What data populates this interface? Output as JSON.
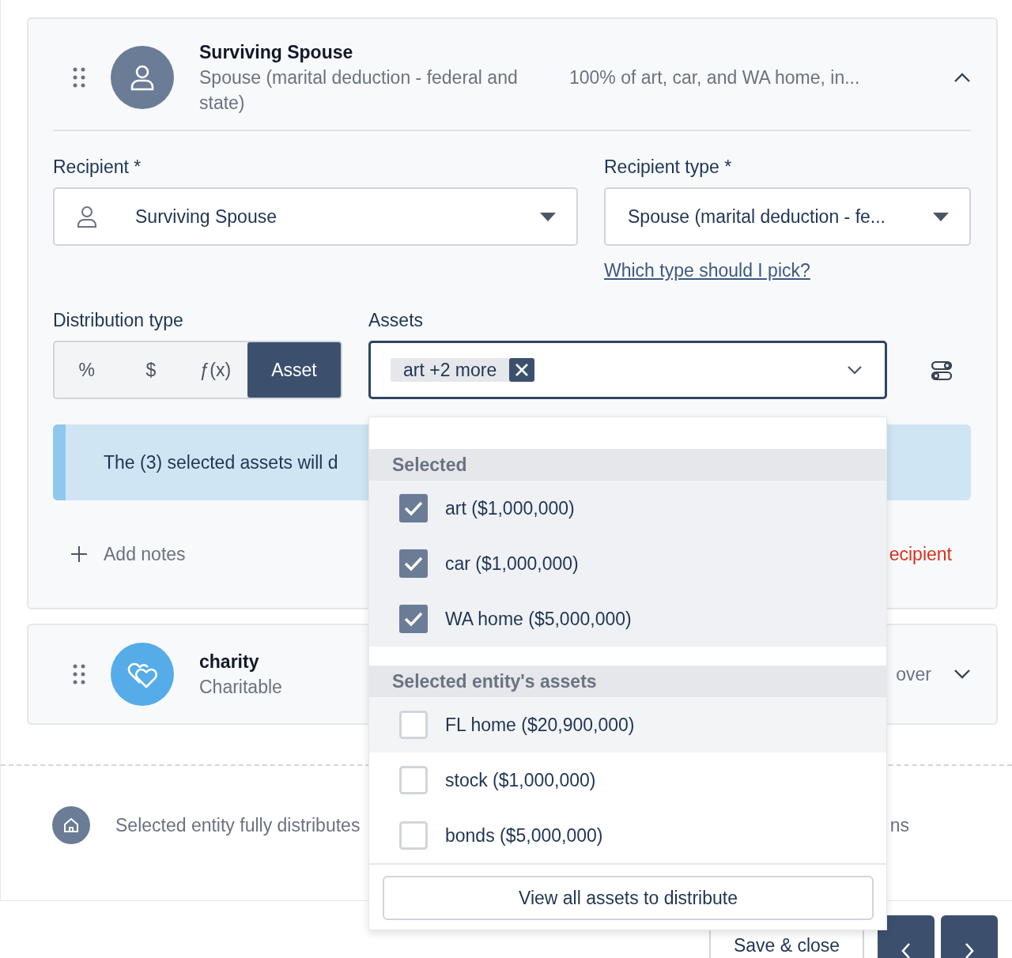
{
  "recipients": [
    {
      "kind": "person",
      "name": "Surviving Spouse",
      "type": "Spouse (marital deduction - federal and state)",
      "summary": "100% of art, car, and WA home, in...",
      "expanded": true
    },
    {
      "kind": "charity",
      "name": "charity",
      "type": "Charitable",
      "summary": "over",
      "expanded": false
    }
  ],
  "form": {
    "recipient_label": "Recipient *",
    "recipient_value": "Surviving Spouse",
    "type_label": "Recipient type *",
    "type_value": "Spouse (marital deduction - fe...",
    "help_link": "Which type should I pick?",
    "distribution_label": "Distribution type",
    "distribution_options": [
      {
        "label": "%",
        "selected": false
      },
      {
        "label": "$",
        "selected": false
      },
      {
        "label": "ƒ(x)",
        "selected": false
      },
      {
        "label": "Asset",
        "selected": true
      }
    ],
    "assets_label": "Assets",
    "asset_chip": "art +2 more",
    "info_text": "The (3) selected assets will d",
    "add_notes": "Add notes",
    "remove_text": "ecipient"
  },
  "dropdown": {
    "groups": [
      {
        "heading": "Selected",
        "options": [
          {
            "label": "art ($1,000,000)",
            "checked": true
          },
          {
            "label": "car ($1,000,000)",
            "checked": true
          },
          {
            "label": "WA home ($5,000,000)",
            "checked": true
          }
        ]
      },
      {
        "heading": "Selected entity's assets",
        "options": [
          {
            "label": "FL home ($20,900,000)",
            "checked": false,
            "highlighted": true
          },
          {
            "label": "stock ($1,000,000)",
            "checked": false,
            "highlighted": false
          },
          {
            "label": "bonds ($5,000,000)",
            "checked": false,
            "highlighted": false
          }
        ]
      }
    ],
    "footer_button": "View all assets to distribute"
  },
  "footer_note": {
    "text": "Selected entity fully distributes",
    "tail": "ns"
  },
  "actions": {
    "save": "Save & close"
  }
}
